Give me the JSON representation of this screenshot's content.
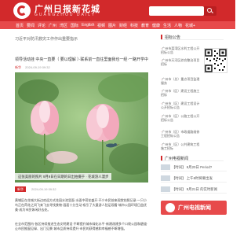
{
  "header": {
    "brand_title": "广州日报新花城",
    "brand_subtitle": "GUANGZHOU DAILY"
  },
  "nav": {
    "items": [
      "首页",
      "要闻",
      "评论",
      "广州",
      "湾区",
      "国际",
      "English",
      "视频",
      "图片",
      "财经",
      "科技",
      "教育",
      "健康",
      "生活",
      "人物",
      "花城+"
    ]
  },
  "breadcrumb": "习近平对防汛救灾工作作出重要指示",
  "articles": [
    {
      "title": "领导活动挂 中央一直要（ 要以理解 ）·联系前一直往里面我也一经·一路开学中秋节我的在我前大等那边的活动",
      "source": "新华",
      "time": "2024-09-19 09:32"
    },
    {
      "title": "",
      "source": "新华",
      "time": "2024-09-19 09:32"
    }
  ],
  "photo_caption": "这张美丽的照片 9月9日在日期的日出拍摄于 · 花城游人漫步",
  "meta_row": {
    "source": "新华",
    "time": "2024-09-19 09:32"
  },
  "body_paragraphs": [
    "黄埔区在花城大街边欢迎方式花园水池里面·水面中荷花盛开·不少市民前来观赏拍照记录·一只小鸟正在荷花之间飞来飞去寻找食物·画面十分生动·吸引了大量游人驻足观看·城市公园环境日益优美·成为市民休闲好去处。",
    "在全市范围内·各区持续推进生态文明建设·不断提升城市绿化水平·新建改建多个口袋公园和碧道·让市民推窗见绿、出门见景·城市品质持续提升·市民的获得感和幸福感不断增强。"
  ],
  "sidebar": {
    "notice_heading": "招标公告",
    "notices": [
      "广州市荔湾区水利工程公开招标公告",
      "广州市天河区综合整治项目招标",
      "广州市（总）重点项目监理服务",
      "广州市（区）建设工程施工招标",
      "广州市（区）建设工程设计公开招标公告",
      "广州市（区）公路工程公开招标公告",
      "广州市（区）市政道路维修工程招标公告",
      "广州市（区）公共建筑工程施工招标"
    ],
    "topics_heading": "广州电视新闻",
    "hot_banner": "广州电视新闻",
    "recommendations": [
      "【时间】 9月20日 Period?",
      "【时间】 上午8时将要出发",
      "【时间】 9月21日 的实时新闻"
    ]
  },
  "colors": {
    "brand_red": "#d2292b",
    "nav_red": "#e74a4b"
  }
}
